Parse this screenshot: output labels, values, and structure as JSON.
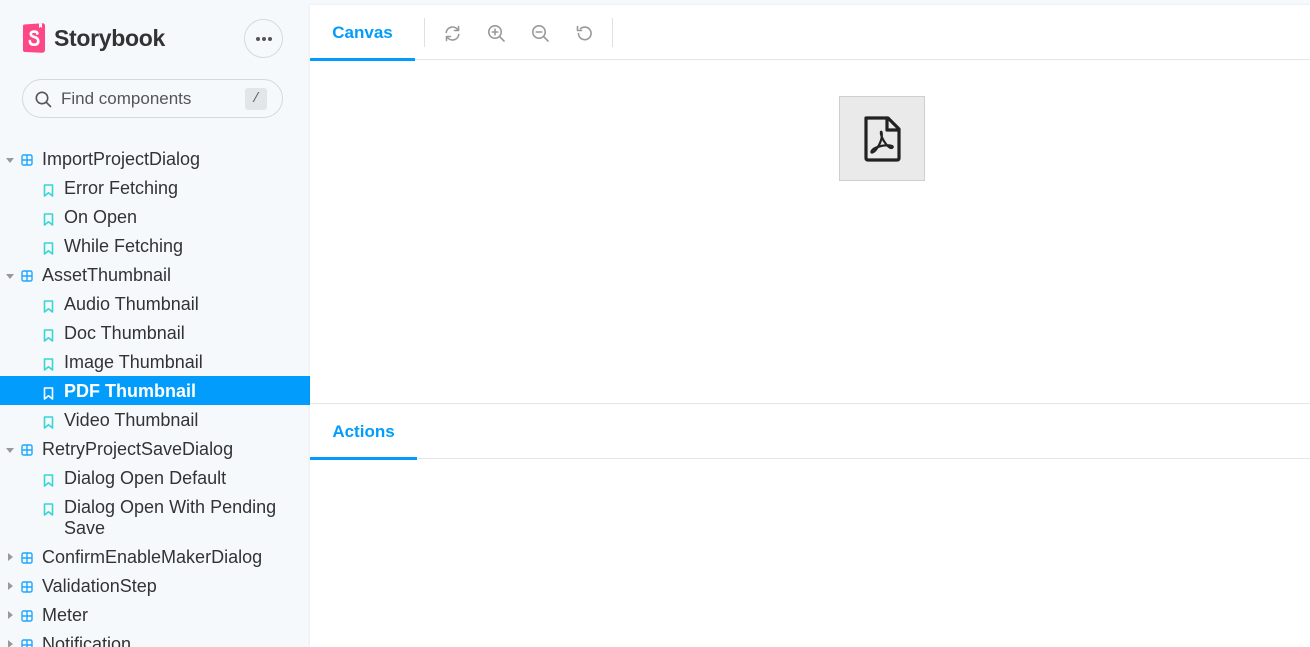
{
  "sidebar": {
    "brand": "Storybook",
    "search": {
      "placeholder": "Find components",
      "shortcut": "/"
    },
    "tree": [
      {
        "type": "component",
        "label": "ImportProjectDialog",
        "expanded": true
      },
      {
        "type": "story",
        "label": "Error Fetching"
      },
      {
        "type": "story",
        "label": "On Open"
      },
      {
        "type": "story",
        "label": "While Fetching"
      },
      {
        "type": "component",
        "label": "AssetThumbnail",
        "expanded": true
      },
      {
        "type": "story",
        "label": "Audio Thumbnail"
      },
      {
        "type": "story",
        "label": "Doc Thumbnail"
      },
      {
        "type": "story",
        "label": "Image Thumbnail"
      },
      {
        "type": "story",
        "label": "PDF Thumbnail",
        "selected": true
      },
      {
        "type": "story",
        "label": "Video Thumbnail"
      },
      {
        "type": "component",
        "label": "RetryProjectSaveDialog",
        "expanded": true
      },
      {
        "type": "story",
        "label": "Dialog Open Default"
      },
      {
        "type": "story",
        "label": "Dialog Open With Pending Save"
      },
      {
        "type": "component",
        "label": "ConfirmEnableMakerDialog",
        "expanded": false
      },
      {
        "type": "component",
        "label": "ValidationStep",
        "expanded": false
      },
      {
        "type": "component",
        "label": "Meter",
        "expanded": false
      },
      {
        "type": "component",
        "label": "Notification",
        "expanded": false
      }
    ]
  },
  "toolbar": {
    "tabs": {
      "canvas": "Canvas"
    },
    "tools": [
      "reload-icon",
      "zoom-in-icon",
      "zoom-out-icon",
      "reset-zoom-icon"
    ]
  },
  "addons": {
    "tabs": {
      "actions": "Actions"
    }
  },
  "colors": {
    "accent": "#029cfd",
    "brand": "#ff4785",
    "story_icon": "#37d5d3",
    "component_icon": "#1ea7fd"
  }
}
